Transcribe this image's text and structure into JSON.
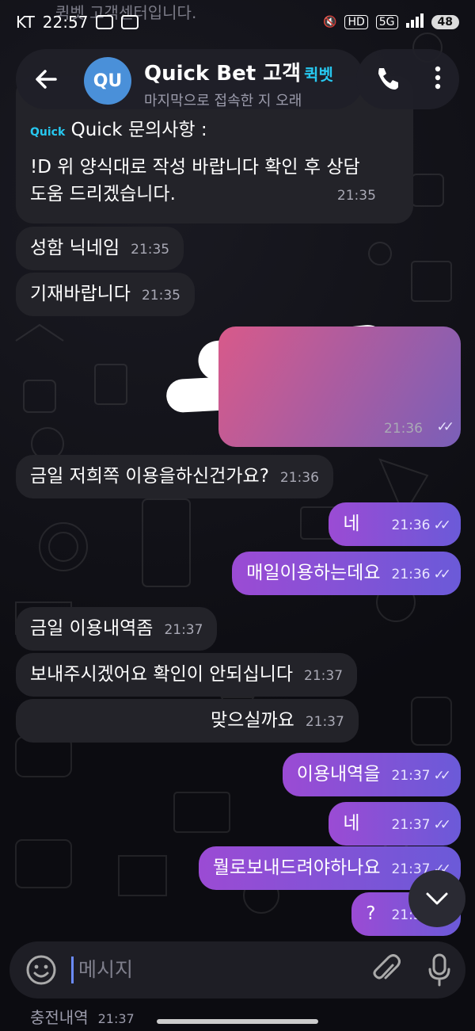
{
  "status": {
    "carrier": "KT",
    "time": "22:57",
    "network": "5G",
    "hd": "HD",
    "battery": "48"
  },
  "header": {
    "avatar_initials": "QU",
    "title": "Quick Bet 고객",
    "badge": "퀵벳",
    "subtitle": "마지막으로 접속한 지 오래"
  },
  "top_peek": "퀵벳 고객센터입니다.",
  "messages": [
    {
      "id": "m1",
      "lines": [
        "Quick 문의사항 :",
        "",
        "!D 위 양식대로 작성 바랍니다 확인 후 상담",
        "도움 드리겠습니다."
      ],
      "time": "21:35"
    },
    {
      "id": "m2",
      "text": "성함 닉네임",
      "time": "21:35"
    },
    {
      "id": "m3",
      "text": "기재바랍니다",
      "time": "21:35"
    },
    {
      "id": "m4",
      "text": "",
      "time": "21:36"
    },
    {
      "id": "m5",
      "text": "금일 저희쪽 이용을하신건가요?",
      "time": "21:36"
    },
    {
      "id": "m6",
      "text": "네",
      "time": "21:36"
    },
    {
      "id": "m7",
      "text": "매일이용하는데요",
      "time": "21:36"
    },
    {
      "id": "m8",
      "text": "금일 이용내역좀",
      "time": "21:37"
    },
    {
      "id": "m9",
      "text": "보내주시겠어요 확인이 안되십니다",
      "time": "21:37"
    },
    {
      "id": "m10",
      "text": "맞으실까요",
      "time": "21:37"
    },
    {
      "id": "m11",
      "text": "이용내역을",
      "time": "21:37"
    },
    {
      "id": "m12",
      "text": "네",
      "time": "21:37"
    },
    {
      "id": "m13",
      "text": "뭘로보내드려야하나요",
      "time": "21:37"
    },
    {
      "id": "m14",
      "text": "?",
      "time": "21:37"
    }
  ],
  "input": {
    "placeholder": "메시지"
  },
  "bottom_peek": {
    "text": "충전내역",
    "time": "21:37"
  },
  "colors": {
    "accent": "#27c8f0",
    "out_start": "#9b4bd4",
    "out_end": "#6b5ad8",
    "bubble_in": "#232329"
  }
}
